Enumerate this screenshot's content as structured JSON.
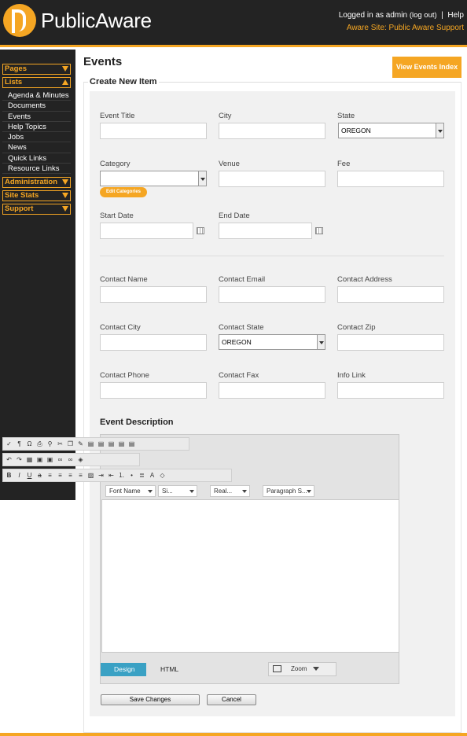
{
  "brand": {
    "name_part1": "Public",
    "name_part2": "Aware",
    "accent": "#f5a623"
  },
  "header": {
    "logged_in": "Logged in as admin",
    "logout": "(log out)",
    "separator": "|",
    "help": "Help",
    "site": "Aware Site: Public Aware Support"
  },
  "sidebar": {
    "pages": "Pages",
    "lists": "Lists",
    "list_items": [
      "Agenda & Minutes",
      "Documents",
      "Events",
      "Help Topics",
      "Jobs",
      "News",
      "Quick Links",
      "Resource Links"
    ],
    "administration": "Administration",
    "site_stats": "Site Stats",
    "support": "Support"
  },
  "main": {
    "title": "Events",
    "view_index": "View Events Index",
    "create_legend": "Create New Item",
    "event_description": "Event Description"
  },
  "form": {
    "event_title": "Event Title",
    "city": "City",
    "state": "State",
    "state_value": "OREGON",
    "category": "Category",
    "edit_categories": "Edit Categories",
    "venue": "Venue",
    "fee": "Fee",
    "start_date": "Start Date",
    "end_date": "End Date",
    "contact_name": "Contact Name",
    "contact_email": "Contact Email",
    "contact_address": "Contact Address",
    "contact_city": "Contact City",
    "contact_state": "Contact State",
    "contact_state_value": "OREGON",
    "contact_zip": "Contact Zip",
    "contact_phone": "Contact Phone",
    "contact_fax": "Contact Fax",
    "info_link": "Info Link"
  },
  "editor": {
    "font_name": "Font Name",
    "size": "Si...",
    "real": "Real...",
    "paragraph": "Paragraph S...",
    "design": "Design",
    "html": "HTML",
    "zoom": "Zoom"
  },
  "buttons": {
    "save": "Save Changes",
    "cancel": "Cancel"
  }
}
